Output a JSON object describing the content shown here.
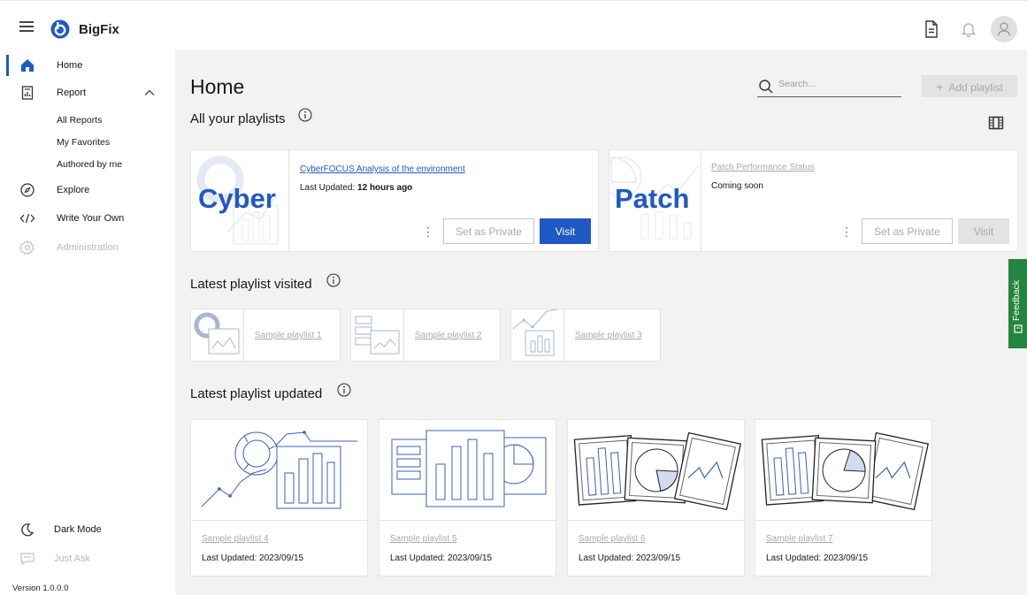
{
  "header": {
    "brand": "BigFix",
    "menu_icon": "hamburger-menu-icon",
    "right_icons": [
      "document-icon",
      "notification-bell-icon",
      "user-avatar-icon"
    ]
  },
  "sidebar": {
    "items": [
      {
        "label": "Home",
        "icon": "home-icon",
        "active": true
      },
      {
        "label": "Report",
        "icon": "report-icon",
        "expanded": true
      },
      {
        "label": "Explore",
        "icon": "compass-icon"
      },
      {
        "label": "Write Your Own",
        "icon": "code-icon"
      },
      {
        "label": "Administration",
        "icon": "gear-icon",
        "disabled": true
      }
    ],
    "report_sub_items": [
      "All Reports",
      "My Favorites",
      "Authored by me"
    ],
    "bottom": [
      {
        "label": "Dark Mode",
        "icon": "moon-icon"
      },
      {
        "label": "Just Ask",
        "icon": "chat-icon",
        "disabled": true
      }
    ],
    "version": "Version 1.0.0.0"
  },
  "main": {
    "title": "Home",
    "search": {
      "placeholder": "Search..."
    },
    "add_playlist_label": "Add playlist",
    "view_toggle_icon": "film-strip-icon",
    "sections": {
      "all": "All your playlists",
      "visited": "Latest playlist visited",
      "updated": "Latest playlist updated"
    },
    "featured": [
      {
        "thumb_word": "Cyber",
        "title": "CyberFOCUS Analysis of the environment",
        "meta_label": "Last Updated:",
        "meta_value": "12 hours ago",
        "private_label": "Set as Private",
        "visit_label": "Visit",
        "enabled": true
      },
      {
        "thumb_word": "Patch",
        "title": "Patch Performance Status",
        "meta_label": "Coming soon",
        "meta_value": "",
        "private_label": "Set as Private",
        "visit_label": "Visit",
        "enabled": false
      }
    ],
    "visited": [
      {
        "label": "Sample playlist 1"
      },
      {
        "label": "Sample playlist 2"
      },
      {
        "label": "Sample playlist 3"
      }
    ],
    "updated": [
      {
        "label": "Sample playlist 4",
        "meta": "Last Updated: 2023/09/15"
      },
      {
        "label": "Sample playlist 5",
        "meta": "Last Updated: 2023/09/15"
      },
      {
        "label": "Sample playlist 6",
        "meta": "Last Updated: 2023/09/15"
      },
      {
        "label": "Sample playlist 7",
        "meta": "Last Updated: 2023/09/15"
      }
    ]
  },
  "feedback": {
    "label": "Feedback"
  },
  "colors": {
    "accent": "#1f59c4",
    "feedback": "#24853e",
    "main_bg": "#f2f2f2"
  }
}
